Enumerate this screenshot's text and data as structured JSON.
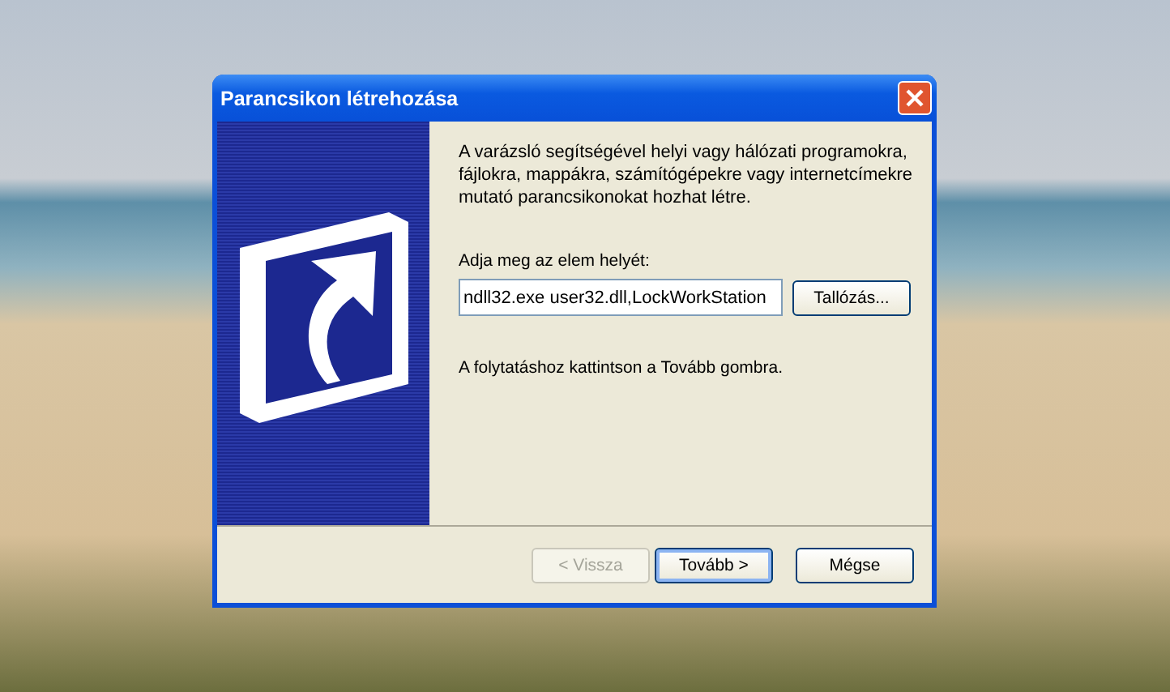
{
  "window": {
    "title": "Parancsikon létrehozása"
  },
  "intro": "A varázsló segítségével helyi vagy hálózati programokra, fájlokra, mappákra, számítógépekre vagy internetcímekre mutató parancsikonokat hozhat létre.",
  "location": {
    "label": "Adja meg az elem helyét:",
    "value": "ndll32.exe user32.dll,LockWorkStation",
    "browse_button": "Tallózás..."
  },
  "hint": "A folytatáshoz kattintson a Tovább gombra.",
  "buttons": [
    {
      "label": "< Vissza",
      "disabled": true,
      "default": false
    },
    {
      "label": "Tovább >",
      "disabled": false,
      "default": true
    },
    {
      "label": "Mégse",
      "disabled": false,
      "default": false
    }
  ]
}
